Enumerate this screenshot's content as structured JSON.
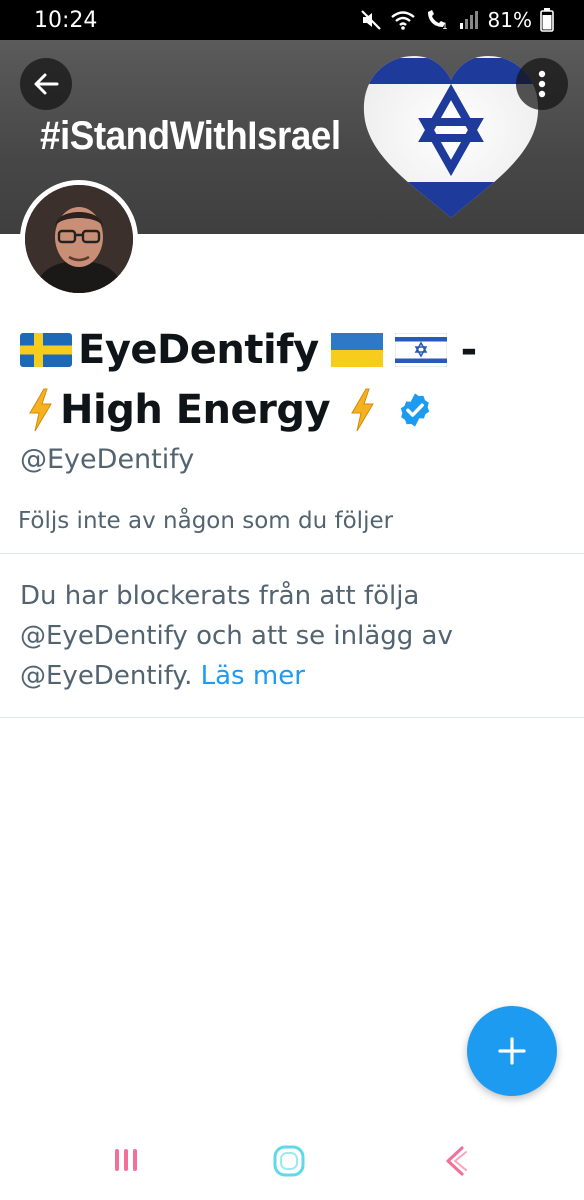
{
  "status_bar": {
    "time": "10:24",
    "battery_percent": "81%",
    "icons": [
      "mute-icon",
      "wifi-icon",
      "call-icon",
      "signal-icon",
      "battery-icon"
    ]
  },
  "banner": {
    "hashtag": "#iStandWithIsrael"
  },
  "profile": {
    "name_segments": [
      "EyeDentify",
      "-",
      "High Energy"
    ],
    "handle": "@EyeDentify",
    "followed_by_text": "Följs inte av någon som du följer",
    "verified": true
  },
  "blocked": {
    "message_line1": "Du har blockerats från att följa",
    "message_line2": "@EyeDentify och att se inlägg av",
    "message_line3": "@EyeDentify.",
    "learn_more": "Läs mer"
  },
  "colors": {
    "accent": "#1d9bf0",
    "secondary_text": "#536471",
    "primary_text": "#0f1419"
  }
}
